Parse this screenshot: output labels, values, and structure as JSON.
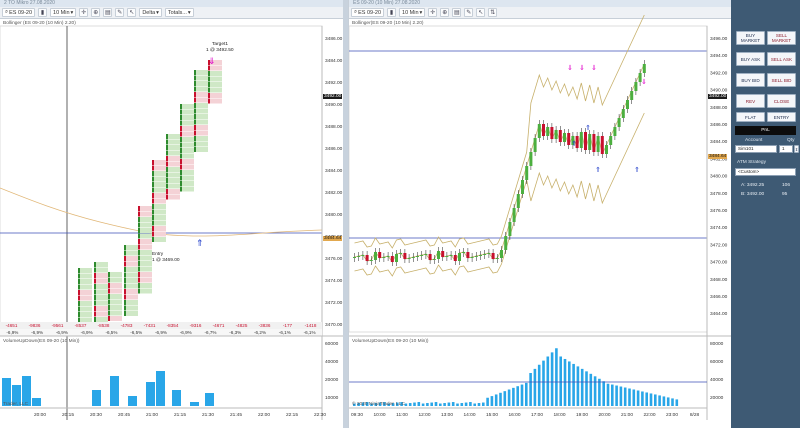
{
  "left": {
    "window_title": "2 TO Mikro 27.08.2020",
    "instrument": "ES 09-20",
    "interval": "10 Min",
    "indicator_dropdown": "Delta",
    "totals_dropdown": "Totals...",
    "info_label": "Bollinger (ES 09-20 (10 Min) 2.20)",
    "target_label": "Target1",
    "target_value": "1 @ 3492.50",
    "entry_label": "Entry",
    "entry_value": "1 @ 3469.00",
    "price_ticks": [
      "3486.00",
      "3484.00",
      "3492.00",
      "3490.00",
      "3488.00",
      "3486.00",
      "3484.00",
      "3482.00",
      "3480.00",
      "3478.00",
      "3476.00",
      "3474.00",
      "3472.00",
      "3470.00"
    ],
    "current_price": "3492.00",
    "last_price": "3484.64",
    "delta_row": [
      "-4651",
      "-9836",
      "-9561",
      "-8537",
      "-8538",
      "-4783",
      "-7431",
      "-8354",
      "-9316",
      "-4671",
      "-4825",
      "-3836",
      "-177",
      "-1418"
    ],
    "pct_row": [
      "-6,9%",
      "-6,9%",
      "-6,9%",
      "-6,9%",
      "-6,5%",
      "-6,5%",
      "-6,9%",
      "-6,9%",
      "-6,7%",
      "-6,3%",
      "-6,2%",
      "-6,1%",
      "-6,1%"
    ],
    "volume_label": "VolumeUpDown(ES 09-20 (10 Min))",
    "volume_ticks": [
      "60000",
      "40000",
      "20000",
      "10000"
    ],
    "time_ticks": [
      "20:00",
      "20:15",
      "20:30",
      "20:45",
      "21:00",
      "21:15",
      "21:30",
      "21:45",
      "22:00",
      "22:15",
      "22:30"
    ],
    "copyright": "Trader, LLC",
    "volume_values": [
      28000,
      21000,
      30000,
      8000,
      0,
      0,
      0,
      0,
      16000,
      30000,
      10000,
      24000,
      35000,
      16000,
      4000,
      13000
    ]
  },
  "right": {
    "window_title": "ES 09-20 (10 Min) 27.08.2020",
    "instrument": "ES 09-20",
    "interval": "10 Min",
    "info_label": "Bollinger(ES 09-20 (10 Min) 2.20)",
    "price_ticks": [
      "3496.00",
      "3494.00",
      "3492.00",
      "3490.00",
      "3488.00",
      "3486.00",
      "3484.00",
      "3482.00",
      "3480.00",
      "3478.00",
      "3476.00",
      "3474.00",
      "3472.00",
      "3470.00",
      "3468.00",
      "3466.00",
      "3464.00"
    ],
    "current_price": "3492.00",
    "last_price": "3484.64",
    "volume_label": "VolumeUpDown(ES 09-20 (10 Min))",
    "volume_ticks": [
      "80000",
      "60000",
      "40000",
      "20000"
    ],
    "time_ticks": [
      "09:30",
      "10:00",
      "11:00",
      "12:00",
      "13:00",
      "14:00",
      "15:00",
      "16:00",
      "17:00",
      "18:00",
      "19:00",
      "20:00",
      "21:00",
      "22:00",
      "23:00",
      "8/28"
    ],
    "copyright": "© 2020 NinjaTrader, LLC"
  },
  "trader": {
    "buy_market": "BUY MARKET",
    "sell_market": "SELL MARKET",
    "buy_ask": "BUY ASK",
    "sell_ask": "SELL ASK",
    "buy_bid": "BUY BID",
    "sell_bid": "SELL BID",
    "rev": "REV",
    "close": "CLOSE",
    "flat": "FLAT",
    "entry": "ENTRY",
    "pnl": "PnL",
    "account_label": "Account",
    "qty_label": "Qty",
    "account_value": "Sim101",
    "qty_value": "1",
    "atm_label": "ATM Strategy",
    "atm_value": "<Custom>",
    "ask_label": "A: 3492.25",
    "ask_size": "106",
    "bid_label": "B: 3492.00",
    "bid_size": "95"
  },
  "colors": {
    "up_bar": "#4caf3f",
    "down_bar": "#c8102e",
    "volume_bar": "#29a6e8",
    "bollinger": "#c7b06b",
    "line_blue": "#1f3fa8",
    "trader_bg": "#3e5a74"
  },
  "icons": [
    "instrument-search-icon",
    "bars-icon",
    "crosshair-icon",
    "zoom-icon",
    "properties-icon",
    "drawing-tools-icon",
    "target-arrow-icon",
    "entry-arrow-icon",
    "chart-trader-icon"
  ]
}
